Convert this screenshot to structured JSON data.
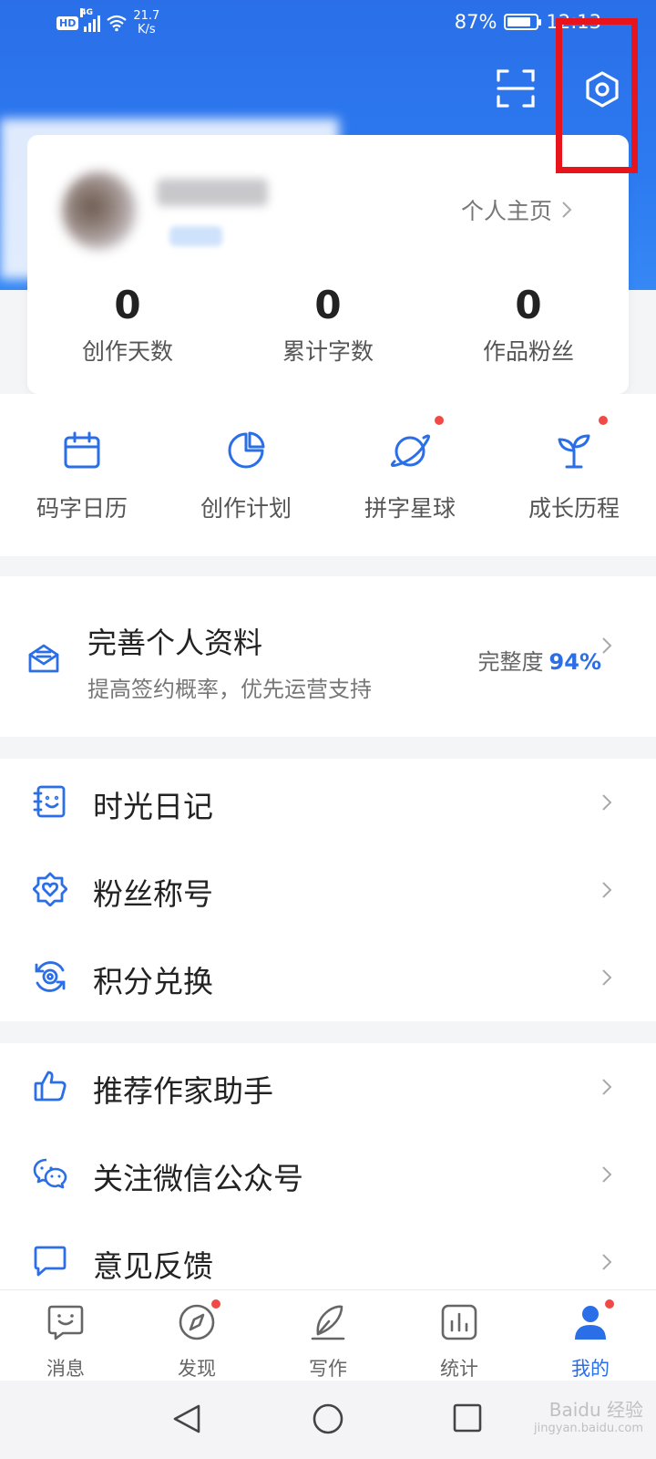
{
  "status_bar": {
    "hd": "HD",
    "network": "4G",
    "speed_value": "21.7",
    "speed_unit": "K/s",
    "battery": "87%",
    "time": "12:13"
  },
  "profile": {
    "homepage_link": "个人主页"
  },
  "stats": [
    {
      "value": "0",
      "label": "创作天数"
    },
    {
      "value": "0",
      "label": "累计字数"
    },
    {
      "value": "0",
      "label": "作品粉丝"
    }
  ],
  "quick_actions": [
    {
      "label": "码字日历",
      "icon": "calendar-icon"
    },
    {
      "label": "创作计划",
      "icon": "pie-chart-icon"
    },
    {
      "label": "拼字星球",
      "icon": "planet-icon"
    },
    {
      "label": "成长历程",
      "icon": "sprout-icon"
    }
  ],
  "completion": {
    "title": "完善个人资料",
    "subtitle": "提高签约概率，优先运营支持",
    "progress_label": "完整度",
    "progress_value": "94%"
  },
  "menu_group_1": [
    {
      "label": "时光日记",
      "icon": "diary-icon"
    },
    {
      "label": "粉丝称号",
      "icon": "badge-heart-icon"
    },
    {
      "label": "积分兑换",
      "icon": "points-exchange-icon"
    }
  ],
  "menu_group_2": [
    {
      "label": "推荐作家助手",
      "icon": "thumbs-up-icon"
    },
    {
      "label": "关注微信公众号",
      "icon": "wechat-icon"
    },
    {
      "label": "意见反馈",
      "icon": "feedback-icon"
    }
  ],
  "tabs": [
    {
      "label": "消息",
      "icon": "message-icon"
    },
    {
      "label": "发现",
      "icon": "compass-icon"
    },
    {
      "label": "写作",
      "icon": "pen-icon"
    },
    {
      "label": "统计",
      "icon": "stats-icon"
    },
    {
      "label": "我的",
      "icon": "user-icon"
    }
  ],
  "watermark": {
    "brand": "Baidu 经验",
    "url": "jingyan.baidu.com"
  },
  "colors": {
    "accent": "#2a6fe8",
    "highlight_box": "#e8141c",
    "notification_dot": "#f04a47"
  }
}
